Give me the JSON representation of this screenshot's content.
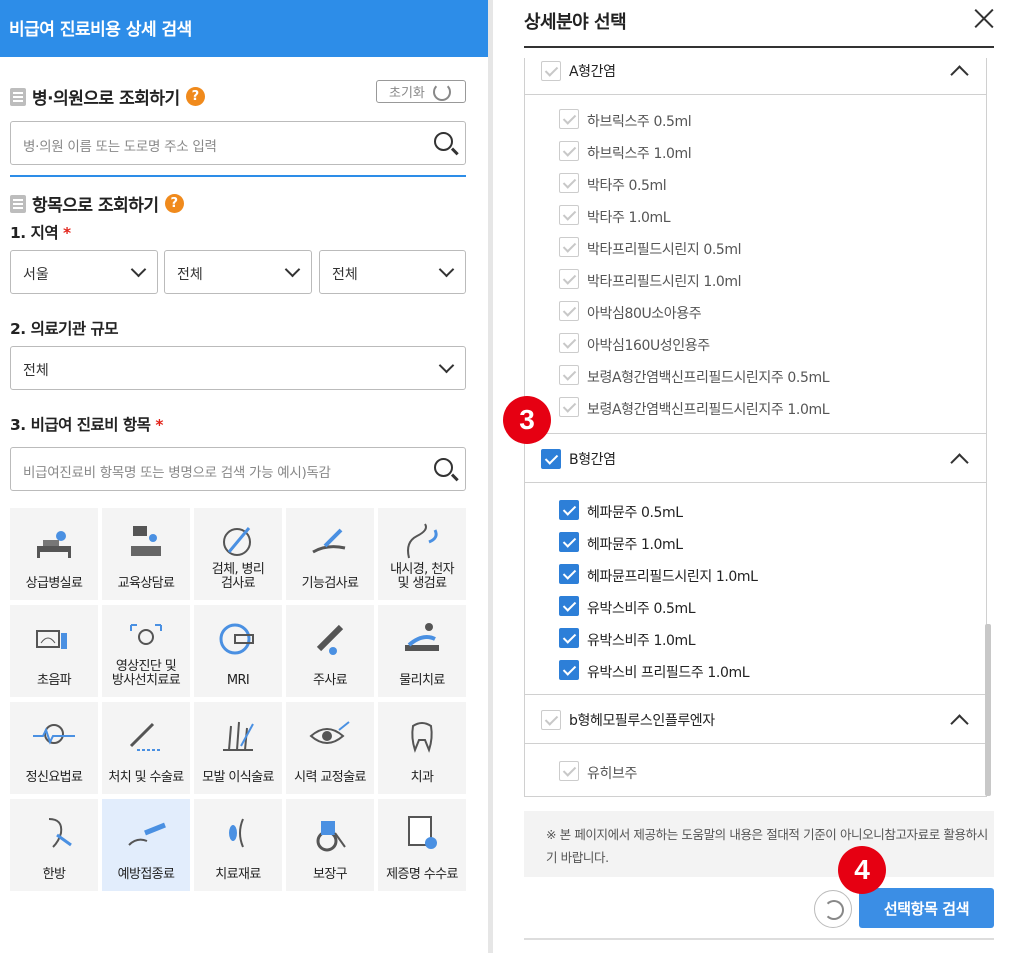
{
  "left": {
    "header_title": "비급여 진료비용 상세 검색",
    "hospital_section": {
      "title": "병·의원으로 조회하기",
      "help": "?",
      "reset_label": "초기화",
      "search_placeholder": "병·의원 이름 또는 도로명 주소 입력"
    },
    "item_section": {
      "title": "항목으로 조회하기",
      "help": "?"
    },
    "region": {
      "label": "1. 지역",
      "required": "*",
      "selects": [
        "서울",
        "전체",
        "전체"
      ]
    },
    "scale": {
      "label": "2. 의료기관 규모",
      "value": "전체"
    },
    "category": {
      "label": "3. 비급여 진료비 항목",
      "required": "*",
      "search_placeholder": "비급여진료비 항목명 또는 병명으로 검색 가능 예시)독감"
    },
    "tiles": [
      {
        "label": "상급병실료",
        "icon": "hospital-bed-icon"
      },
      {
        "label": "교육상담료",
        "icon": "counseling-icon"
      },
      {
        "label": "검체, 병리\n검사료",
        "icon": "lab-test-icon"
      },
      {
        "label": "기능검사료",
        "icon": "function-test-icon"
      },
      {
        "label": "내시경, 천자\n및 생검료",
        "icon": "endoscope-icon"
      },
      {
        "label": "초음파",
        "icon": "ultrasound-icon"
      },
      {
        "label": "영상진단 및\n방사선치료료",
        "icon": "radiology-icon"
      },
      {
        "label": "MRI",
        "icon": "mri-icon"
      },
      {
        "label": "주사료",
        "icon": "syringe-icon"
      },
      {
        "label": "물리치료",
        "icon": "physical-therapy-icon"
      },
      {
        "label": "정신요법료",
        "icon": "brain-icon"
      },
      {
        "label": "처치 및 수술료",
        "icon": "surgery-icon"
      },
      {
        "label": "모발 이식술료",
        "icon": "hair-transplant-icon"
      },
      {
        "label": "시력 교정술료",
        "icon": "eye-icon"
      },
      {
        "label": "치과",
        "icon": "tooth-icon"
      },
      {
        "label": "한방",
        "icon": "ear-acupuncture-icon"
      },
      {
        "label": "예방접종료",
        "icon": "vaccination-icon"
      },
      {
        "label": "치료재료",
        "icon": "treatment-material-icon"
      },
      {
        "label": "보장구",
        "icon": "wheelchair-icon"
      },
      {
        "label": "제증명 수수료",
        "icon": "certificate-icon"
      }
    ],
    "active_tile": "예방접종료"
  },
  "right": {
    "title": "상세분야 선택",
    "groups": [
      {
        "label": "A형간염",
        "checked": false,
        "disabled": true,
        "items": [
          {
            "label": "하브릭스주 0.5ml",
            "checked": false
          },
          {
            "label": "하브릭스주 1.0ml",
            "checked": false
          },
          {
            "label": "박타주 0.5ml",
            "checked": false
          },
          {
            "label": "박타주 1.0mL",
            "checked": false
          },
          {
            "label": "박타프리필드시린지 0.5ml",
            "checked": false
          },
          {
            "label": "박타프리필드시린지 1.0ml",
            "checked": false
          },
          {
            "label": "아박심80U소아용주",
            "checked": false
          },
          {
            "label": "아박심160U성인용주",
            "checked": false
          },
          {
            "label": "보령A형간염백신프리필드시린지주 0.5mL",
            "checked": false
          },
          {
            "label": "보령A형간염백신프리필드시린지주 1.0mL",
            "checked": false
          }
        ]
      },
      {
        "label": "B형간염",
        "checked": true,
        "disabled": false,
        "items": [
          {
            "label": "헤파뮨주 0.5mL",
            "checked": true
          },
          {
            "label": "헤파뮨주 1.0mL",
            "checked": true
          },
          {
            "label": "헤파뮨프리필드시린지 1.0mL",
            "checked": true
          },
          {
            "label": "유박스비주 0.5mL",
            "checked": true
          },
          {
            "label": "유박스비주 1.0mL",
            "checked": true
          },
          {
            "label": "유박스비 프리필드주 1.0mL",
            "checked": true
          }
        ]
      },
      {
        "label": "b형헤모필루스인플루엔자",
        "checked": false,
        "disabled": true,
        "items": [
          {
            "label": "유히브주",
            "checked": false
          }
        ]
      }
    ],
    "note": "※ 본 페이지에서 제공하는 도움말의 내용은 절대적 기준이 아니오니참고자료로 활용하시기 바랍니다.",
    "search_button": "선택항목 검색",
    "badges": [
      "3",
      "4"
    ]
  },
  "colors": {
    "brand": "#2d8de8",
    "checkbox_on": "#2d7fd8",
    "badge": "#e60012",
    "help": "#f08a1c"
  }
}
